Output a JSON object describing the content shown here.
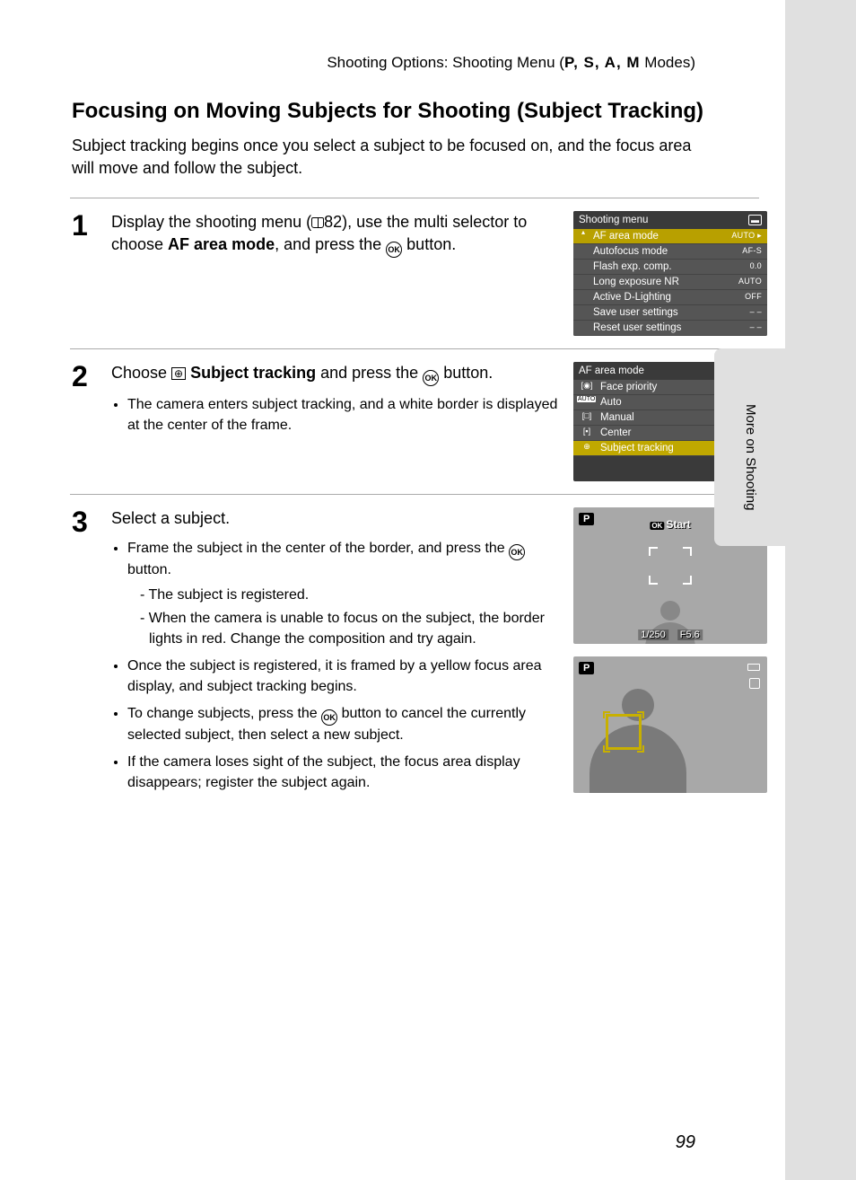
{
  "header": {
    "prefix": "Shooting Options: Shooting Menu (",
    "modes": "P, S, A, M",
    "suffix": " Modes)"
  },
  "title": "Focusing on Moving Subjects for Shooting (Subject Tracking)",
  "intro": "Subject tracking begins once you select a subject to be focused on, and the focus area will move and follow the subject.",
  "steps": {
    "s1": {
      "num": "1",
      "text_a": "Display the shooting menu (",
      "text_ref": "82), use the multi selector to choose ",
      "bold": "AF area mode",
      "text_b": ", and press the ",
      "text_c": " button."
    },
    "s2": {
      "num": "2",
      "text_a": "Choose ",
      "bold": "Subject tracking",
      "text_b": " and press the ",
      "text_c": " button.",
      "bullets": {
        "b1": "The camera enters subject tracking, and a white border is displayed at the center of the frame."
      }
    },
    "s3": {
      "num": "3",
      "text": "Select a subject.",
      "bullets": {
        "b1a": "Frame the subject in the center of the border, and press the ",
        "b1b": " button.",
        "b1_d1": "The subject is registered.",
        "b1_d2": "When the camera is unable to focus on the subject, the border lights in red. Change the composition and try again.",
        "b2": "Once the subject is registered, it is framed by a yellow focus area display, and subject tracking begins.",
        "b3a": "To change subjects, press the ",
        "b3b": " button to cancel the currently selected subject, then select a new subject.",
        "b4": "If the camera loses sight of the subject, the focus area display disappears; register the subject again."
      }
    }
  },
  "lcd1": {
    "title": "Shooting menu",
    "rows": [
      {
        "label": "AF area mode",
        "val": "AUTO ▸"
      },
      {
        "label": "Autofocus mode",
        "val": "AF-S"
      },
      {
        "label": "Flash exp. comp.",
        "val": "0.0"
      },
      {
        "label": "Long exposure NR",
        "val": "AUTO"
      },
      {
        "label": "Active D-Lighting",
        "val": "OFF"
      },
      {
        "label": "Save user settings",
        "val": "– –"
      },
      {
        "label": "Reset user settings",
        "val": "– –"
      }
    ],
    "pcol": "P"
  },
  "lcd2": {
    "title": "AF area mode",
    "rows": [
      {
        "icon": "[◉]",
        "label": "Face priority"
      },
      {
        "icon": "AUTO",
        "label": "Auto"
      },
      {
        "icon": "[□]",
        "label": "Manual"
      },
      {
        "icon": "[▪]",
        "label": "Center"
      },
      {
        "icon": "⊕",
        "label": "Subject tracking"
      }
    ]
  },
  "cv1": {
    "p": "P",
    "start": "Start",
    "shutter": "1/250",
    "aperture": "F5.6"
  },
  "cv2": {
    "p": "P"
  },
  "side_label": "More on Shooting",
  "page_num": "99"
}
